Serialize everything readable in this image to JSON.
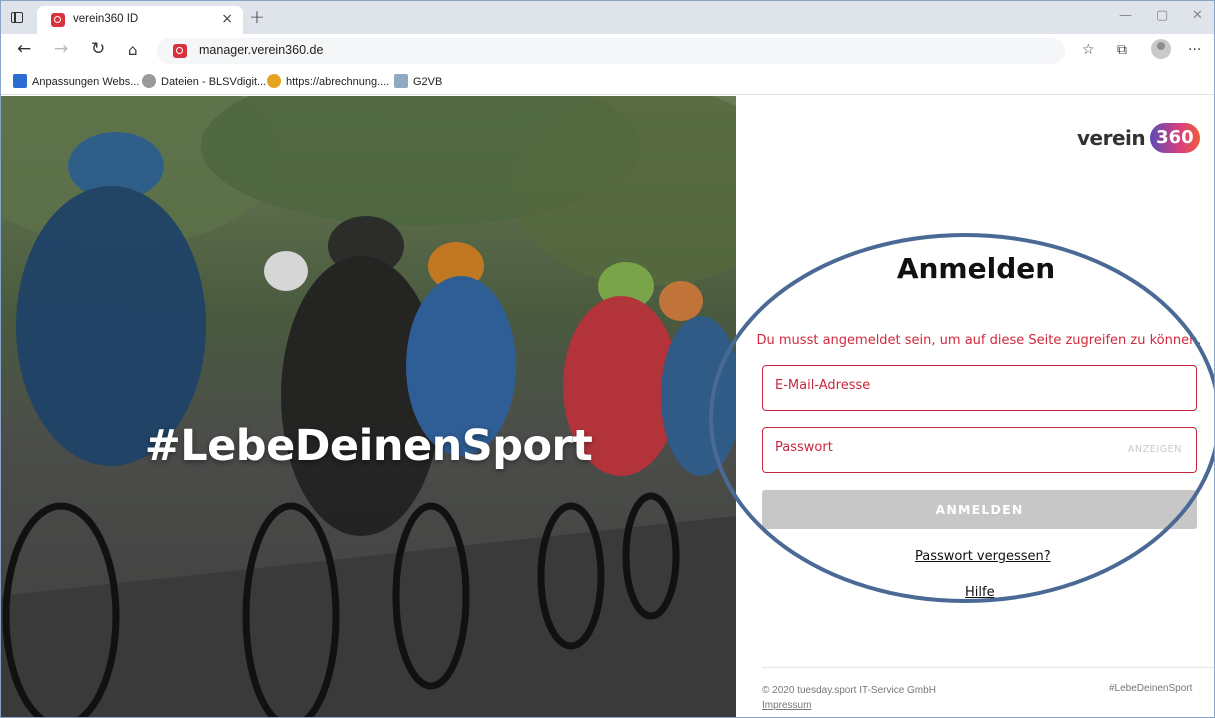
{
  "browser": {
    "tab_title": "verein360 ID",
    "tab_close": "×",
    "new_tab": "+",
    "url": "manager.verein360.de",
    "window_controls": [
      "—",
      "▢",
      "✕"
    ],
    "bookmarks": [
      {
        "label": "Anpassungen Webs...",
        "icon": "document-icon",
        "color": "#2b6cd4"
      },
      {
        "label": "Dateien - BLSVdigit...",
        "icon": "cloud-icon",
        "color": "#9a9a9a"
      },
      {
        "label": "https://abrechnung....",
        "icon": "sun-icon",
        "color": "#e6a320"
      },
      {
        "label": "G2VB",
        "icon": "image-icon",
        "color": "#8fa9c2"
      }
    ]
  },
  "hero": {
    "slogan": "#LebeDeinenSport"
  },
  "login": {
    "logo_word": "verein",
    "logo_badge": "360",
    "heading": "Anmelden",
    "warning": "Du musst angemeldet sein, um auf diese Seite zugreifen zu können.",
    "email_placeholder": "E-Mail-Adresse",
    "password_placeholder": "Passwort",
    "show_password": "ANZEIGEN",
    "submit": "ANMELDEN",
    "forgot": "Passwort vergessen?",
    "help": "Hilfe"
  },
  "footer": {
    "copyright": "© 2020 tuesday.sport IT-Service GmbH",
    "imprint": "Impressum",
    "hashtag": "#LebeDeinenSport"
  },
  "colors": {
    "accent_red": "#c8283d",
    "annotation_ellipse": "#4a6a95"
  }
}
